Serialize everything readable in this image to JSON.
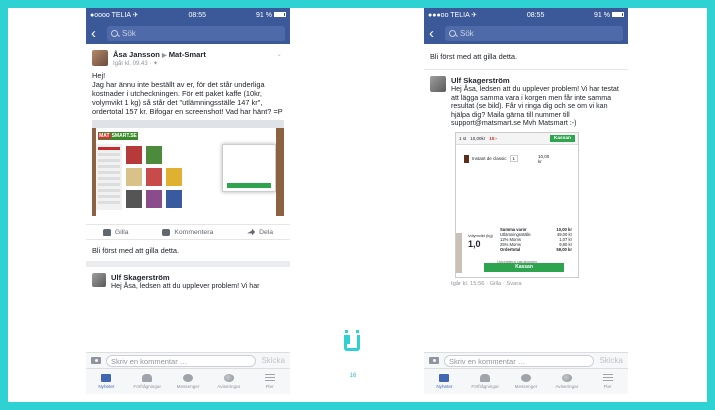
{
  "colors": {
    "frame": "#2fd2d2",
    "fb_blue": "#3b5998",
    "active_tab": "#4267b2"
  },
  "status": {
    "carrier": "●oooo TELIA ✈",
    "carrier_right": "●●●oo TELIA ✈",
    "time": "08:55",
    "battery": "91 %"
  },
  "nav": {
    "back_icon": "chevron-left-icon",
    "search_placeholder": "Sök"
  },
  "post": {
    "author": "Åsa Jansson",
    "arrow": "▶",
    "group": "Mat-Smart",
    "meta": "Igår kl. 09.43 · ✦",
    "text": "Hej!\nJag har ännu inte beställt av er, för det står underliga kostnader i utcheckningen. För ett paket kaffe (10kr, volymvikt 1 kg) så står det \"utlämningsställe 147 kr\", ordertotal 157 kr. Bifogar en screenshot! Vad har hänt? =P",
    "screenshot": {
      "logo_left": "MAT",
      "logo_right": "SMART.SE"
    }
  },
  "actions": {
    "like": "Gilla",
    "comment": "Kommentera",
    "share": "Dela"
  },
  "first_like": "Bli först med att gilla detta.",
  "comment": {
    "author": "Ulf Skagerström",
    "preview": "Hej Åsa, ledsen att du upplever problem! Vi har",
    "text": "Hej Åsa, ledsen att du upplever problem! Vi har testat att lägga samma vara i korgen men får inte samma resultat (se bild). Får vi ringa dig och se om vi kan hjälpa dig? Maila gärna till nummer till support@matsmart.se Mvh Matsmart :-)",
    "meta": "Igår kl. 15:56 · Gilla · Svara",
    "cart": {
      "count": "1 st",
      "total_small": "10,00kr",
      "discount": "10:-",
      "checkout": "Kassan",
      "item": "Instant de classic",
      "qty": "1",
      "item_price": "10,00 kr",
      "rows": [
        {
          "label": "Summa varor",
          "value": "10,00 kr"
        },
        {
          "label": "Utlämningsställe",
          "value": "49,00 kr"
        },
        {
          "label": "12% Moms",
          "value": "1,07 kr"
        },
        {
          "label": "25% Moms",
          "value": "9,80 kr"
        },
        {
          "label": "Ordertotal",
          "value": "59,00 kr"
        }
      ],
      "weight_label": "Volymvikt (kg)",
      "weight": "1,0",
      "update": "Uppdatera varukorgen",
      "checkout_button": "Kassan"
    }
  },
  "composer": {
    "placeholder": "Skriv en kommentar …",
    "send": "Skicka"
  },
  "tabs": [
    {
      "label": "Nyheter",
      "icon": "news-feed-icon"
    },
    {
      "label": "Förfrågningar",
      "icon": "friend-requests-icon"
    },
    {
      "label": "Messenger",
      "icon": "messenger-icon"
    },
    {
      "label": "Aviseringar",
      "icon": "globe-icon"
    },
    {
      "label": "Fler",
      "icon": "menu-icon"
    }
  ],
  "page_number": "16"
}
